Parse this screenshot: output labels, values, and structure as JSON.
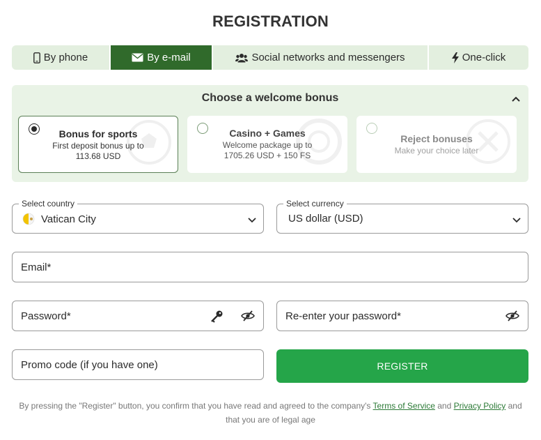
{
  "page": {
    "title": "REGISTRATION"
  },
  "tabs": [
    {
      "label": "By phone",
      "icon": "phone-icon"
    },
    {
      "label": "By e-mail",
      "icon": "envelope-icon"
    },
    {
      "label": "Social networks and messengers",
      "icon": "users-icon"
    },
    {
      "label": "One-click",
      "icon": "lightning-icon"
    }
  ],
  "bonus": {
    "title": "Choose a welcome bonus",
    "options": [
      {
        "name": "Bonus for sports",
        "desc1": "First deposit bonus up to",
        "desc2": "113.68 USD"
      },
      {
        "name": "Casino + Games",
        "desc1": "Welcome package up to",
        "desc2": "1705.26 USD + 150 FS"
      },
      {
        "name": "Reject bonuses",
        "desc1": "Make your choice later"
      }
    ]
  },
  "form": {
    "country": {
      "label": "Select country",
      "value": "Vatican City"
    },
    "currency": {
      "label": "Select currency",
      "value": "US dollar (USD)"
    },
    "email": {
      "placeholder": "Email*"
    },
    "password": {
      "placeholder": "Password*"
    },
    "repassword": {
      "placeholder": "Re-enter your password*"
    },
    "promo": {
      "placeholder": "Promo code (if you have one)"
    },
    "register_label": "REGISTER"
  },
  "terms": {
    "before": "By pressing the \"Register\" button, you confirm that you have read and agreed to the company's ",
    "tos": "Terms of Service",
    "and": " and ",
    "privacy": "Privacy Policy",
    "after": " and that you are of legal age"
  },
  "colors": {
    "accent_dark": "#306a2b",
    "accent": "#25a549",
    "panel": "#e9f3e6"
  }
}
